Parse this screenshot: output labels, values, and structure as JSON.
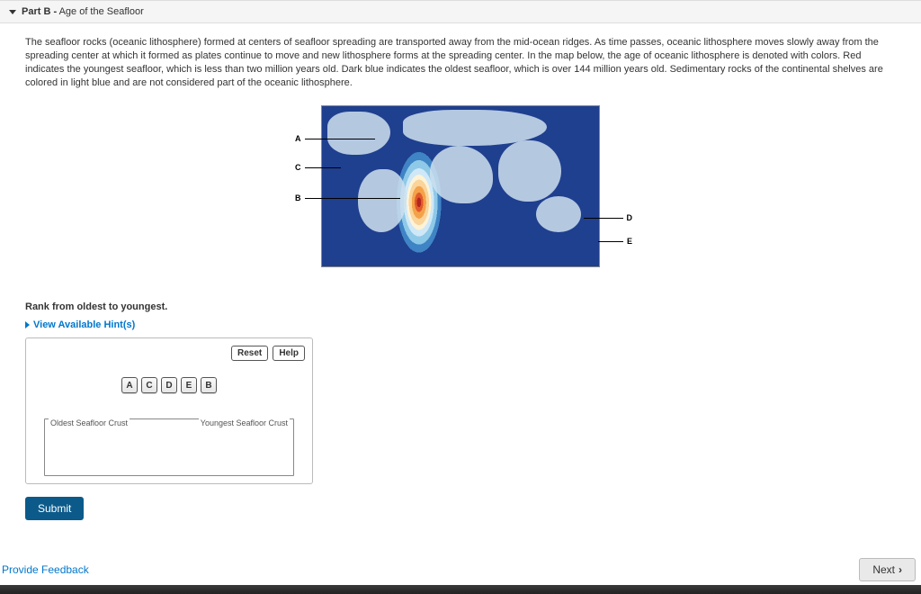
{
  "header": {
    "part_label": "Part B -",
    "title": "Age of the Seafloor"
  },
  "intro": {
    "paragraph": "The seafloor rocks (oceanic lithosphere) formed at centers of seafloor spreading are transported away from the mid-ocean ridges. As time passes, oceanic lithosphere moves slowly away from the spreading center at which it formed as plates continue to move and new lithosphere forms at the spreading center. In the map below, the age of oceanic lithosphere is denoted with colors. Red indicates the youngest seafloor, which is less than two million years old. Dark blue indicates the oldest seafloor, which is over 144 million years old. Sedimentary rocks of the continental shelves are colored in light blue and are not considered part of the oceanic lithosphere."
  },
  "map": {
    "labels": {
      "A": "A",
      "B": "B",
      "C": "C",
      "D": "D",
      "E": "E"
    }
  },
  "ranking": {
    "instruction": "Rank from oldest to youngest.",
    "hints_label": "View Available Hint(s)",
    "reset_label": "Reset",
    "help_label": "Help",
    "tiles": [
      "A",
      "C",
      "D",
      "E",
      "B"
    ],
    "dropzone_left": "Oldest Seafloor Crust",
    "dropzone_right": "Youngest Seafloor Crust",
    "submit_label": "Submit"
  },
  "footer": {
    "feedback": "Provide Feedback",
    "next": "Next"
  }
}
